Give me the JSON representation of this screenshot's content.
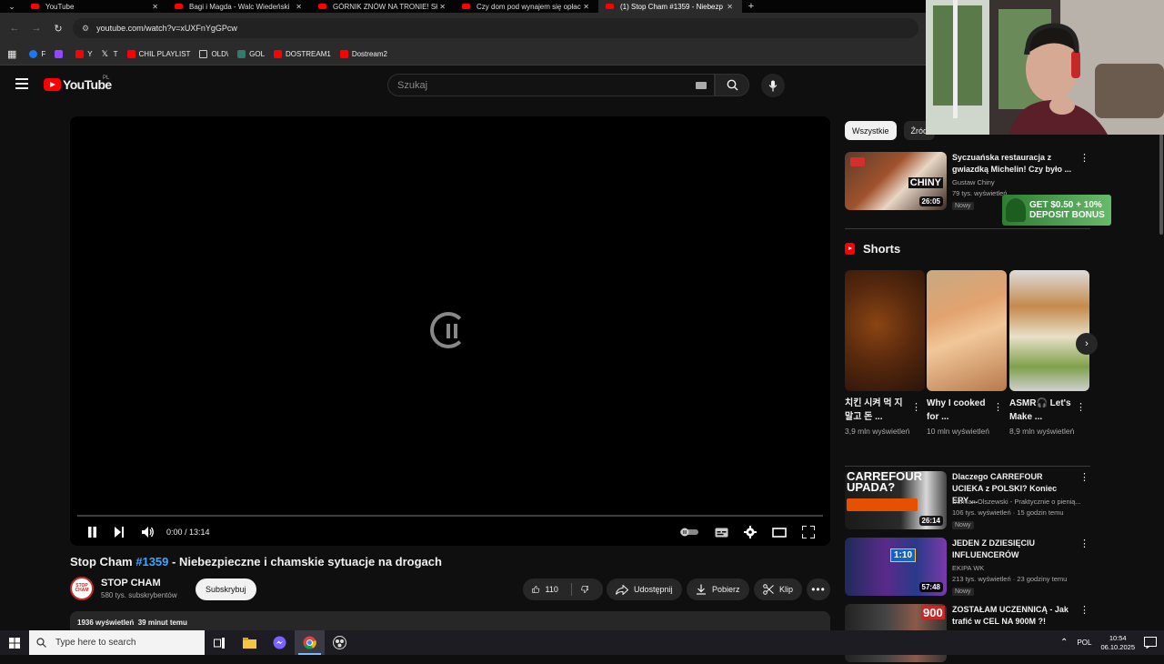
{
  "browser": {
    "tabs": [
      {
        "title": "YouTube",
        "active": false
      },
      {
        "title": "Bagi i Magda - Walc Wiedeński",
        "active": false
      },
      {
        "title": "GÓRNIK ZNÓW NA TRONIE! Słi",
        "active": false
      },
      {
        "title": "Czy dom pod wynajem się opłaca",
        "active": false
      },
      {
        "title": "(1) Stop Cham #1359 - Niebezp",
        "active": true
      }
    ],
    "url": "youtube.com/watch?v=xUXFnYgGPcw",
    "bookmarks": [
      {
        "label": "F",
        "color": "#1877f2"
      },
      {
        "label": "",
        "color": "#9146ff"
      },
      {
        "label": "Y",
        "color": "#ff0000"
      },
      {
        "label": "T",
        "color": "#000000"
      },
      {
        "label": "CHIL PLAYLIST",
        "color": "#ff0000"
      },
      {
        "label": "OLD\\",
        "color": "folder"
      },
      {
        "label": "GOL",
        "color": "#2e7d6b"
      },
      {
        "label": "DOSTREAM1",
        "color": "#ff0000"
      },
      {
        "label": "Dostream2",
        "color": "#ff0000"
      }
    ]
  },
  "masthead": {
    "logo_text": "YouTube",
    "region": "PL",
    "search_placeholder": "Szukaj"
  },
  "player": {
    "time": "0:00 / 13:14",
    "progress": 0
  },
  "video": {
    "title_prefix": "Stop Cham ",
    "title_hashtag": "#1359",
    "title_suffix": " - Niebezpieczne i chamskie sytuacje na drogach",
    "channel_name": "STOP CHAM",
    "avatar_text": "STOP CHAM",
    "subscribers": "580 tys. subskrybentów",
    "subscribe_label": "Subskrybuj",
    "likes": "110",
    "share_label": "Udostępnij",
    "download_label": "Pobierz",
    "clip_label": "Klip",
    "description_meta": "1936 wyświetleń  39 minut temu"
  },
  "sidebar": {
    "chips": [
      "Wszystkie",
      "Źród"
    ],
    "recommendations_top": [
      {
        "title": "Syczuańska restauracja z gwiazdką Michelin! Czy było ...",
        "channel": "Gustaw Chiny",
        "meta": "79 tys. wyświetleń",
        "badge": "Nowy",
        "duration": "26:05",
        "thumb_text": "CHINY"
      }
    ],
    "ad_text": "GET $0.50 + 10% DEPOSIT BONUS",
    "shorts_heading": "Shorts",
    "shorts": [
      {
        "title": "치킨 시켜 먹 지말고 돈 ...",
        "views": "3,9 mln wyświetleń"
      },
      {
        "title": "Why I cooked for ...",
        "views": "10 mln wyświetleń"
      },
      {
        "title": "ASMR🎧 Let's Make ...",
        "views": "8,9 mln wyświetleń"
      }
    ],
    "recommendations": [
      {
        "title": "Dlaczego CARREFOUR UCIEKA z POLSKI? Koniec ERY ...",
        "channel": "Damian Olszewski - Praktycznie o pienią...",
        "meta": "106 tys. wyświetleń · 15 godzin temu",
        "badge": "Nowy",
        "duration": "26:14",
        "thumb_text": "CARREFOUR UPADA?"
      },
      {
        "title": "JEDEN Z DZIESIĘCIU INFLUENCERÓW",
        "channel": "EKIPA WK",
        "meta": "213 tys. wyświetleń · 23 godziny temu",
        "badge": "Nowy",
        "duration": "57:48",
        "thumb_text": "1:10"
      },
      {
        "title": "ZOSTAŁAM UCZENNICĄ - Jak trafić w CEL NA 900M ?!",
        "channel": "",
        "meta": "",
        "badge": "",
        "duration": "",
        "thumb_text": "900"
      }
    ]
  },
  "taskbar": {
    "search_placeholder": "Type here to search",
    "language": "POL",
    "time": "10:54",
    "date": "06.10.2025"
  }
}
